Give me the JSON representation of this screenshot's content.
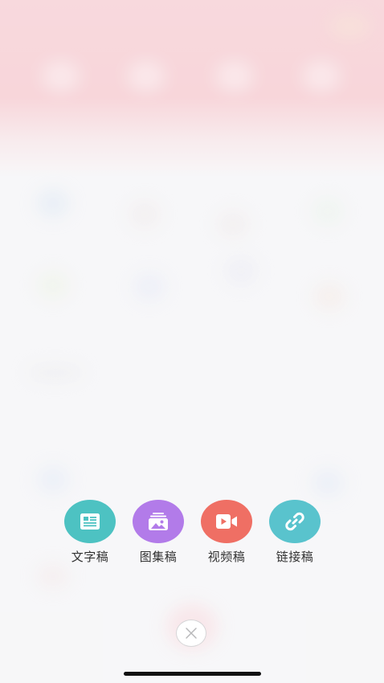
{
  "publish_menu": {
    "options": [
      {
        "label": "文字稿",
        "icon": "article-icon",
        "color": "#4dc2c2"
      },
      {
        "label": "图集稿",
        "icon": "gallery-icon",
        "color": "#b27be9"
      },
      {
        "label": "视频稿",
        "icon": "video-icon",
        "color": "#ef6f64"
      },
      {
        "label": "链接稿",
        "icon": "link-icon",
        "color": "#59c3cd"
      }
    ],
    "close_icon": "close-icon"
  },
  "colors": {
    "header_pink": "#f7c3c8",
    "background": "#f6f6f7",
    "label_text": "#333333"
  }
}
